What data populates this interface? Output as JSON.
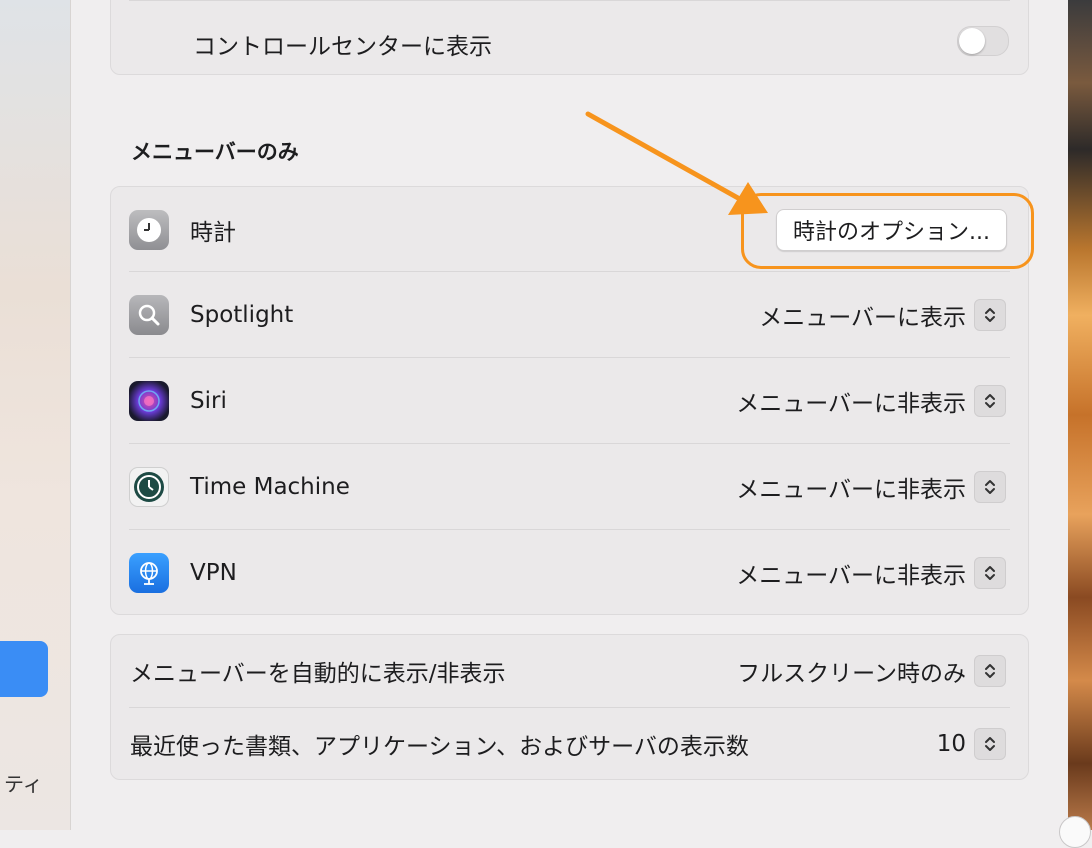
{
  "sidebar": {
    "partial_label": "ティ"
  },
  "control_center": {
    "label": "コントロールセンターに表示",
    "toggle_on": false
  },
  "menu_bar_only": {
    "title": "メニューバーのみ",
    "items": [
      {
        "icon": "clock-icon",
        "label": "時計",
        "button": "時計のオプション..."
      },
      {
        "icon": "spotlight-icon",
        "label": "Spotlight",
        "value": "メニューバーに表示"
      },
      {
        "icon": "siri-icon",
        "label": "Siri",
        "value": "メニューバーに非表示"
      },
      {
        "icon": "time-machine-icon",
        "label": "Time Machine",
        "value": "メニューバーに非表示"
      },
      {
        "icon": "vpn-icon",
        "label": "VPN",
        "value": "メニューバーに非表示"
      }
    ]
  },
  "bottom": {
    "autohide_label": "メニューバーを自動的に表示/非表示",
    "autohide_value": "フルスクリーン時のみ",
    "recent_label": "最近使った書類、アプリケーション、およびサーバの表示数",
    "recent_value": "10"
  },
  "colors": {
    "accent": "#3a8df5",
    "annotation": "#f7941d"
  }
}
